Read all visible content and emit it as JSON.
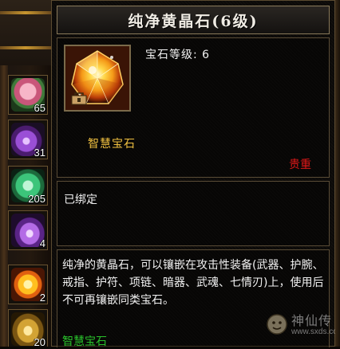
{
  "tooltip": {
    "title": "纯净黄晶石(6级)",
    "level_line": "宝石等级: 6",
    "gem_name": "智慧宝石",
    "rarity": "贵重",
    "bind_status": "已绑定",
    "description": "纯净的黄晶石，可以镶嵌在攻击性装备(武器、护腕、戒指、护符、项链、暗器、武魂、七情刃)上，使用后不可再镶嵌同类宝石。",
    "extra_line": "智慧宝石"
  },
  "inventory": {
    "slots": [
      {
        "icon": "pink-flower-icon",
        "count": "65"
      },
      {
        "icon": "purple-potion-icon",
        "count": "31"
      },
      {
        "icon": "jade-disc-icon",
        "count": "205"
      },
      {
        "icon": "purple-bottle-icon",
        "count": "4"
      },
      {
        "icon": "yellow-gem-icon",
        "count": "2"
      },
      {
        "icon": "gold-ore-icon",
        "count": "20"
      }
    ]
  },
  "watermark": {
    "site": "www.sxds.com",
    "logo_text": "神仙传"
  },
  "colors": {
    "title_text": "#f0ece4",
    "gem_name": "#f0c040",
    "rarity": "#e01818",
    "green_text": "#29c12b",
    "border": "#5a4c36"
  }
}
